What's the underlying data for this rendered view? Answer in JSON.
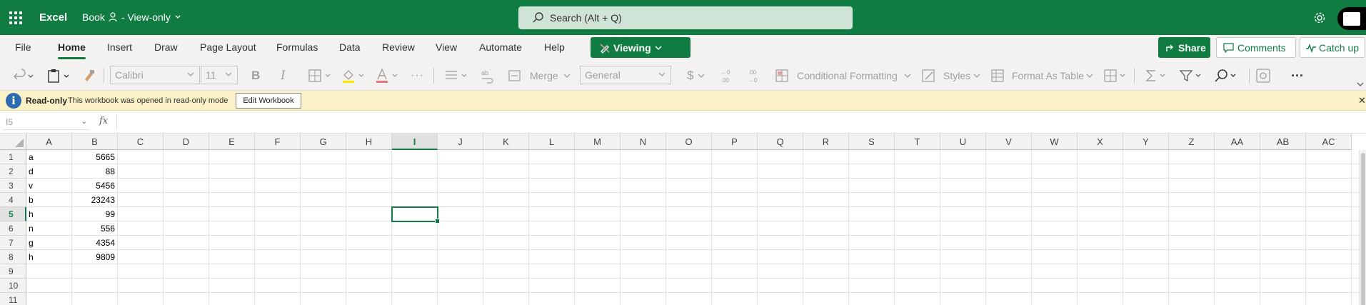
{
  "titlebar": {
    "app_name": "Excel",
    "doc_title": "Book",
    "doc_mode": "- View-only",
    "search_placeholder": "Search (Alt + Q)"
  },
  "tabs": [
    "File",
    "Home",
    "Insert",
    "Draw",
    "Page Layout",
    "Formulas",
    "Data",
    "Review",
    "View",
    "Automate",
    "Help"
  ],
  "active_tab": "Home",
  "mode_button": "Viewing",
  "actions": {
    "share": "Share",
    "comments": "Comments",
    "catch_up": "Catch up"
  },
  "toolbar": {
    "font": "Calibri",
    "font_size": "11",
    "bold": "B",
    "italic": "I",
    "merge": "Merge",
    "number_format": "General",
    "currency": "$",
    "conditional_formatting": "Conditional Formatting",
    "styles": "Styles",
    "format_as_table": "Format As Table"
  },
  "infobar": {
    "title": "Read-only",
    "message": "This workbook was opened in read-only mode",
    "edit_button": "Edit Workbook"
  },
  "formula_bar": {
    "name_box": "I5",
    "fx": "fx",
    "value": ""
  },
  "grid": {
    "columns": [
      "A",
      "B",
      "C",
      "D",
      "E",
      "F",
      "G",
      "H",
      "I",
      "J",
      "K",
      "L",
      "M",
      "N",
      "O",
      "P",
      "Q",
      "R",
      "S",
      "T",
      "U",
      "V",
      "W",
      "X",
      "Y",
      "Z",
      "AA",
      "AB",
      "AC"
    ],
    "selected_column": "I",
    "rows": [
      "1",
      "2",
      "3",
      "4",
      "5",
      "6",
      "7",
      "8",
      "9",
      "10",
      "11"
    ],
    "selected_row": "5",
    "data": [
      {
        "a": "a",
        "b": "5665"
      },
      {
        "a": "d",
        "b": "88"
      },
      {
        "a": "v",
        "b": "5456"
      },
      {
        "a": "b",
        "b": "23243"
      },
      {
        "a": "h",
        "b": "99"
      },
      {
        "a": "n",
        "b": "556"
      },
      {
        "a": "g",
        "b": "4354"
      },
      {
        "a": "h",
        "b": "9809"
      }
    ]
  },
  "colors": {
    "brand": "#107c41",
    "infobar": "#fbf1c6"
  }
}
